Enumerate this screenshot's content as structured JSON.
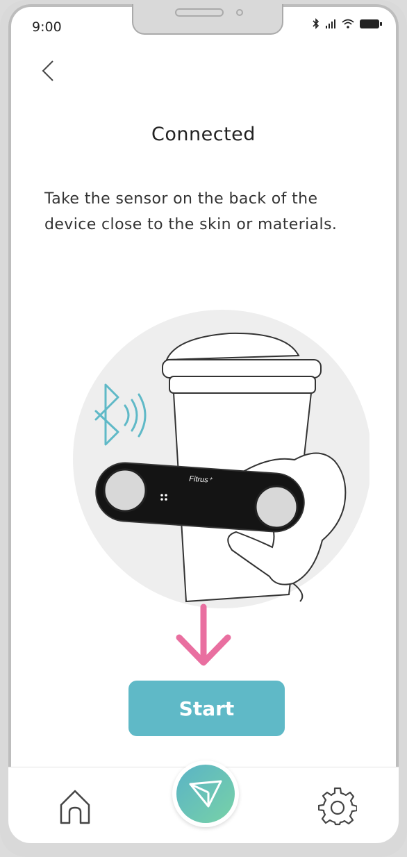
{
  "status_bar": {
    "time": "9:00"
  },
  "page": {
    "title": "Connected",
    "description": "Take the sensor on the back of the device close to the skin or materials."
  },
  "illustration": {
    "device_brand": "Fitrus⁺"
  },
  "actions": {
    "start_label": "Start"
  },
  "colors": {
    "accent": "#5fb9c7",
    "arrow": "#e96fa0",
    "bluetooth": "#5fb9c7"
  },
  "tabbar": {
    "items": [
      {
        "icon": "home-icon"
      },
      {
        "icon": "send-icon"
      },
      {
        "icon": "gear-icon"
      }
    ]
  }
}
